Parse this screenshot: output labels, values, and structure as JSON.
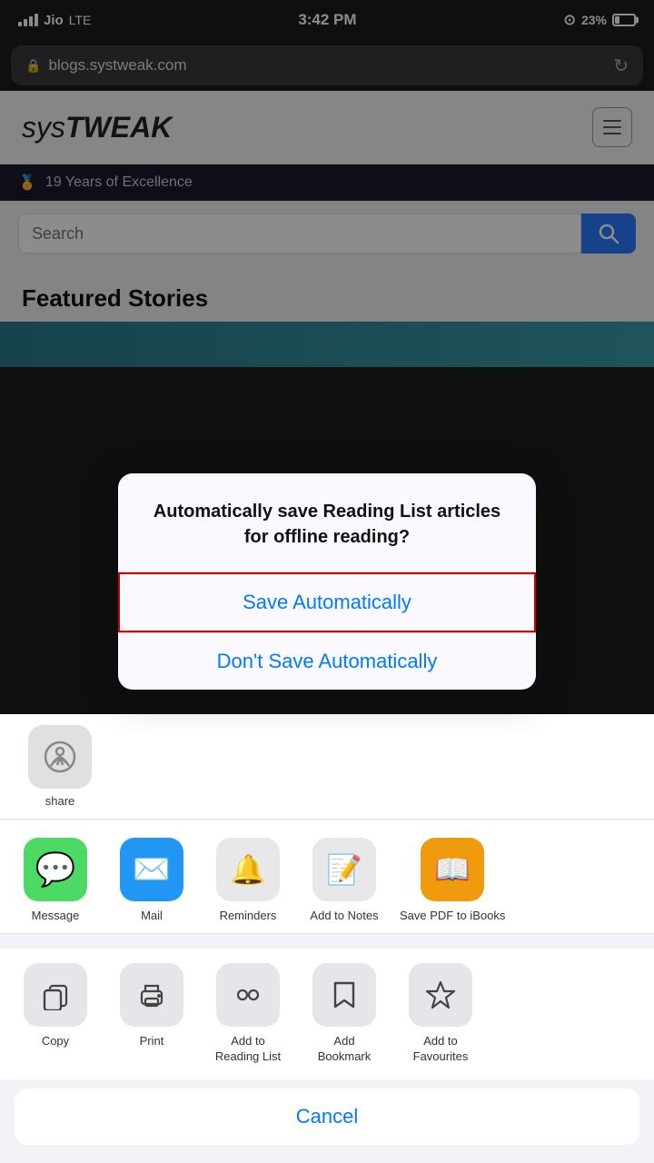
{
  "statusBar": {
    "carrier": "Jio",
    "network": "LTE",
    "time": "3:42 PM",
    "battery": "23%"
  },
  "addressBar": {
    "url": "blogs.systweak.com",
    "lockIcon": "🔒",
    "reloadIcon": "↻"
  },
  "siteHeader": {
    "logoText1": "sys",
    "logoText2": "TWeak",
    "menuIcon": "menu"
  },
  "goldBanner": {
    "icon": "🥇",
    "text": "19 Years of Excellence"
  },
  "search": {
    "placeholder": "Search",
    "buttonIcon": "🔍"
  },
  "featured": {
    "title": "Featured Stories"
  },
  "dialog": {
    "title": "Automatically save Reading List articles for offline reading?",
    "saveBtn": "Save Automatically",
    "noSaveBtn": "Don't Save Automatically"
  },
  "shareIcons": [
    {
      "label": "Message",
      "bg": "#4cd964",
      "icon": "💬"
    },
    {
      "label": "Mail",
      "bg": "#2196f3",
      "icon": "✉️"
    },
    {
      "label": "Reminders",
      "bg": "#e8e8e8",
      "icon": "🔔"
    },
    {
      "label": "Add to Notes",
      "bg": "#e8e8e8",
      "icon": "📝"
    },
    {
      "label": "Save PDF to iBooks",
      "bg": "#f09a0e",
      "icon": "📖"
    }
  ],
  "shareActions": [
    {
      "label": "Copy",
      "icon": "📋"
    },
    {
      "label": "Print",
      "icon": "🖨️"
    },
    {
      "label": "Add to\nReading List",
      "icon": "👓"
    },
    {
      "label": "Add\nBookmark",
      "icon": "🔖"
    },
    {
      "label": "Add to\nFavourites",
      "icon": "⭐"
    }
  ],
  "airdropArea": {
    "label": "share"
  },
  "cancelBtn": "Cancel"
}
